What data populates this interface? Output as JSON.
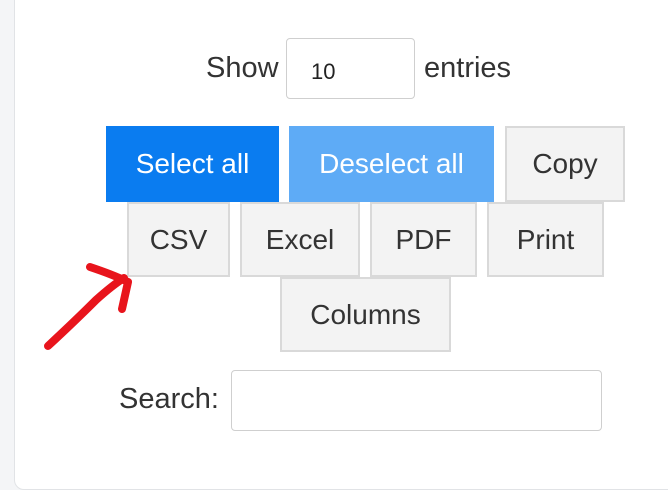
{
  "length_control": {
    "prefix": "Show",
    "value": "10",
    "suffix": "entries"
  },
  "buttons": {
    "select_all": "Select all",
    "deselect_all": "Deselect all",
    "copy": "Copy",
    "csv": "CSV",
    "excel": "Excel",
    "pdf": "PDF",
    "print": "Print",
    "columns": "Columns"
  },
  "search": {
    "label": "Search:",
    "value": ""
  },
  "colors": {
    "primary": "#0a7cf0",
    "primary_light": "#5eabf6",
    "annotation": "#e8141c"
  },
  "annotation": {
    "icon": "red-hand-drawn-arrow-icon"
  }
}
